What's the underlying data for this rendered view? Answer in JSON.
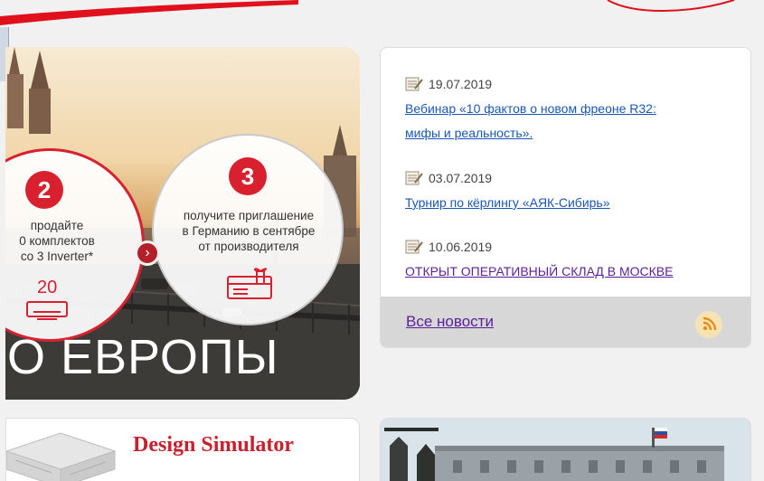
{
  "banner": {
    "step2": {
      "number": "2",
      "text_lines": [
        "продайте",
        "0 комплектов",
        "co 3 Inverter*"
      ],
      "count": "20"
    },
    "step3": {
      "number": "3",
      "text_lines": [
        "получите  приглашение",
        "в Германию в сентябре",
        "от производителя"
      ]
    },
    "caption": "О ЕВРОПЫ"
  },
  "news": {
    "items": [
      {
        "date": "19.07.2019",
        "title": "Вебинар «10 фактов о новом фреоне R32: мифы и реальность».",
        "title_lines": [
          "Вебинар «10 фактов о новом фреоне R32:",
          "мифы и реальность»."
        ]
      },
      {
        "date": "03.07.2019",
        "title": "Турнир по кёрлингу «АЯК-Сибирь»",
        "title_lines": [
          "Турнир по кёрлингу «АЯК-Сибирь»"
        ]
      },
      {
        "date": "10.06.2019",
        "title": "ОТКРЫТ ОПЕРАТИВНЫЙ СКЛАД В МОСКВЕ",
        "title_lines": [
          "ОТКРЫТ ОПЕРАТИВНЫЙ СКЛАД В МОСКВЕ"
        ]
      }
    ],
    "all_news_label": "Все новости",
    "rss_icon": "rss-icon"
  },
  "promo": {
    "design_simulator_title": "Design Simulator"
  },
  "colors": {
    "brand_red": "#d8202f",
    "link_blue": "#1a57b4",
    "link_visited": "#5b1f9a"
  }
}
